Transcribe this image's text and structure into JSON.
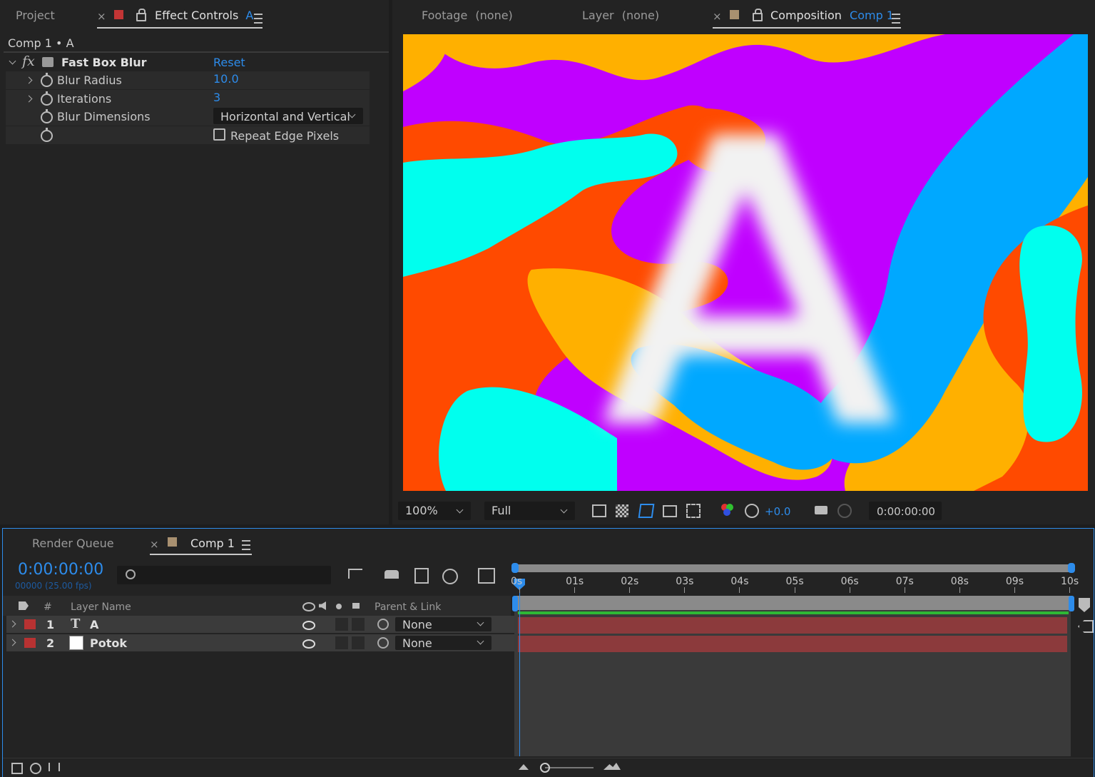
{
  "left_panel": {
    "tabs": [
      {
        "label": "Project"
      },
      {
        "label": "Effect Controls",
        "suffix": "A"
      }
    ],
    "breadcrumb": "Comp 1 • A",
    "effect": {
      "name": "Fast Box Blur",
      "reset": "Reset",
      "fx": "fx",
      "properties": [
        {
          "label": "Blur Radius",
          "value": "10.0"
        },
        {
          "label": "Iterations",
          "value": "3"
        },
        {
          "label": "Blur Dimensions",
          "value": "Horizontal and Vertical"
        },
        {
          "label": "",
          "checkbox_label": "Repeat Edge Pixels"
        }
      ]
    }
  },
  "viewer": {
    "tabs": [
      {
        "label": "Footage",
        "value": "(none)"
      },
      {
        "label": "Layer",
        "value": "(none)"
      },
      {
        "label": "Composition",
        "value": "Comp 1"
      }
    ],
    "canvas_letter": "A",
    "colors": {
      "purple": "#c000ff",
      "orange": "#ffb000",
      "red": "#ff4a00",
      "cyan": "#00ffee",
      "blue": "#00a8ff"
    },
    "toolbar": {
      "zoom": "100%",
      "resolution": "Full",
      "exposure": "+0.0",
      "timecode": "0:00:00:00"
    }
  },
  "timeline": {
    "tabs": [
      {
        "label": "Render Queue"
      },
      {
        "label": "Comp 1"
      }
    ],
    "timecode": "0:00:00:00",
    "frame_info": "00000 (25.00 fps)",
    "search_placeholder": "",
    "columns": {
      "hash": "#",
      "layer_name": "Layer Name",
      "parent": "Parent & Link"
    },
    "layers": [
      {
        "num": "1",
        "type": "T",
        "name": "A",
        "parent": "None",
        "color": "#b83232"
      },
      {
        "num": "2",
        "type": "solid",
        "name": "Potok",
        "parent": "None",
        "color": "#b83232"
      }
    ],
    "ruler": [
      "0s",
      "01s",
      "02s",
      "03s",
      "04s",
      "05s",
      "06s",
      "07s",
      "08s",
      "09s",
      "10s"
    ]
  }
}
